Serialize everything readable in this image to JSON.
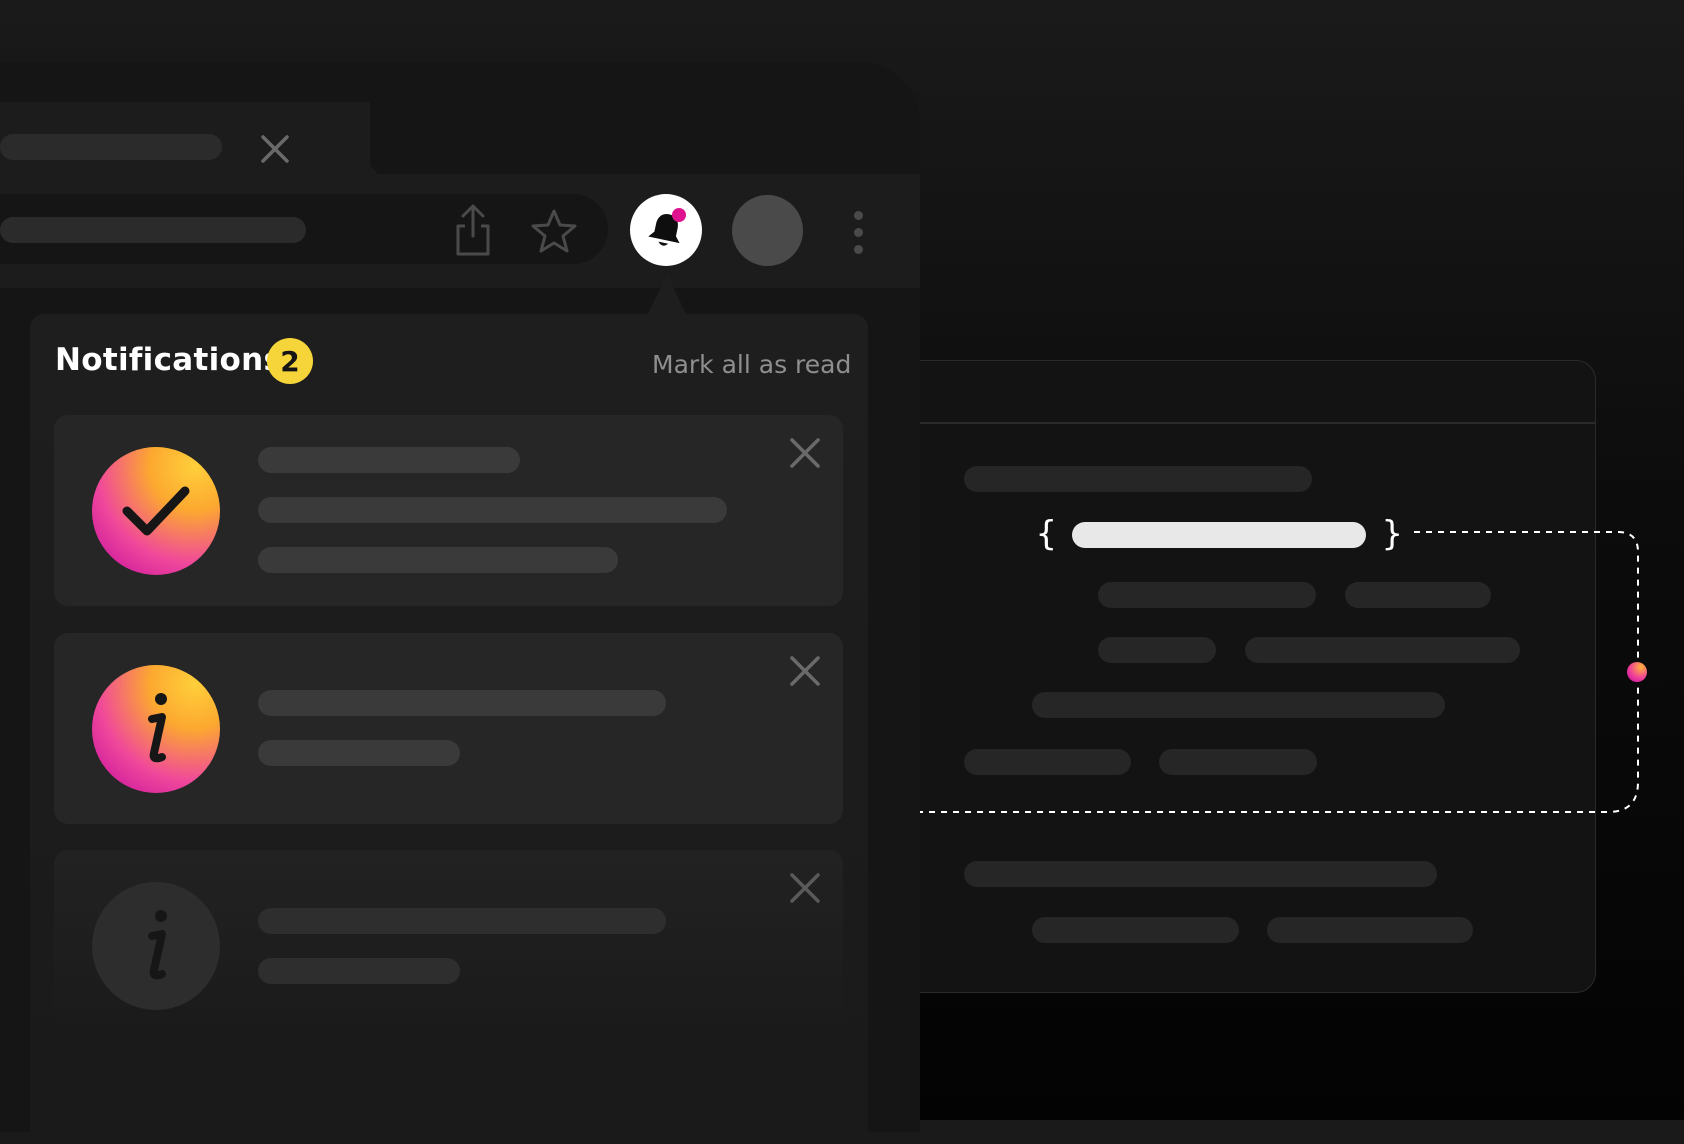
{
  "panel": {
    "title": "Notifications",
    "badge_count": "2",
    "mark_all_label": "Mark all as read"
  },
  "notifications": [
    {
      "type": "success",
      "icon": "checkmark-icon",
      "state": "unread"
    },
    {
      "type": "info",
      "icon": "info-icon",
      "state": "unread"
    },
    {
      "type": "info",
      "icon": "info-icon",
      "state": "read"
    }
  ],
  "toolbar": {
    "icons": [
      "share-icon",
      "star-icon",
      "bell-icon",
      "avatar",
      "more-vertical-icon"
    ],
    "bell_has_indicator": true
  },
  "colors": {
    "badge": "#f5d53a",
    "accent_gradient_start": "#ffcf3a",
    "accent_gradient_end": "#c0089f",
    "indicator": "#e0138f"
  }
}
